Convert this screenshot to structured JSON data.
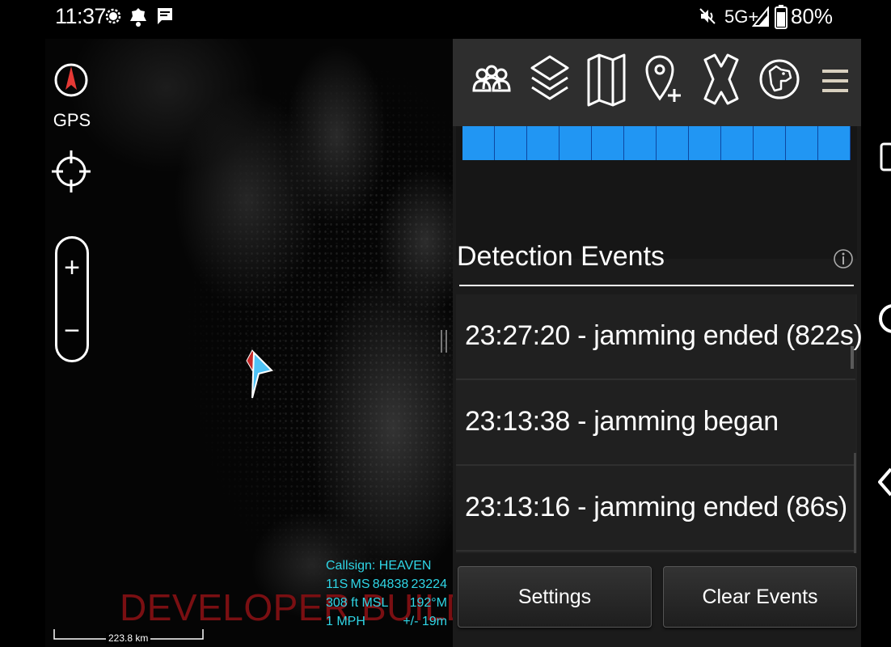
{
  "status_bar": {
    "time": "11:37",
    "network": "5G+",
    "battery": "80%",
    "icons": [
      "signal-messenger-icon",
      "notification-bell-icon",
      "message-icon",
      "mute-icon",
      "cell-signal-icon",
      "battery-icon"
    ]
  },
  "map": {
    "gps_label": "GPS",
    "watermark": "DEVELOPER BUILD",
    "scale_label": "223.8 km",
    "callsign_line": "Callsign: HEAVEN",
    "mgrs_zone": "11S",
    "mgrs_grid": "MS",
    "mgrs_easting": "84838",
    "mgrs_northing": "23224",
    "altitude": "308 ft MSL",
    "heading": "192°M",
    "speed": "1 MPH",
    "accuracy": "+/- 19m",
    "zoom_in_label": "+",
    "zoom_out_label": "−"
  },
  "toolbar": {
    "icons": [
      "contacts-icon",
      "layers-icon",
      "map-icon",
      "add-point-icon",
      "close-tool-icon",
      "alert-dog-icon",
      "overflow-menu-icon"
    ]
  },
  "spectrum": {
    "cell_count": 12,
    "color": "#2196f3"
  },
  "detection_events": {
    "title": "Detection Events",
    "events": [
      {
        "text": "23:27:20 - jamming ended (822s)"
      },
      {
        "text": "23:13:38 - jamming began"
      },
      {
        "text": "23:13:16 - jamming ended (86s)"
      }
    ]
  },
  "actions": {
    "settings_label": "Settings",
    "clear_label": "Clear Events"
  },
  "colors": {
    "accent_blue": "#2196f3",
    "info_cyan": "#2fd6e6",
    "watermark_red": "#7a0f12",
    "compass_red": "#e53935"
  }
}
